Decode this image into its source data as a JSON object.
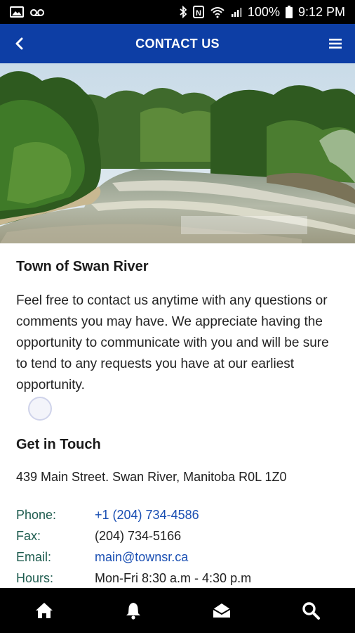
{
  "status_bar": {
    "battery": "100%",
    "time": "9:12 PM"
  },
  "app_bar": {
    "title": "CONTACT US"
  },
  "hero": {
    "alt": "River flowing through trees"
  },
  "content": {
    "org_name": "Town of Swan River",
    "intro": "Feel free to contact us anytime with any questions or comments you may have. We appreciate having the opportunity to communicate with you and will be sure to tend to any requests you have at our earliest opportunity.",
    "section_title": "Get in Touch",
    "address": "439 Main Street. Swan River, Manitoba R0L 1Z0",
    "contacts": [
      {
        "label": "Phone:",
        "value": "+1 (204) 734-4586"
      },
      {
        "label": "Fax:",
        "value": "(204) 734-5166"
      },
      {
        "label": "Email:",
        "value": "main@townsr.ca"
      },
      {
        "label": "Hours:",
        "value": "Mon-Fri 8:30 a.m - 4:30 p.m"
      }
    ]
  },
  "bottom_nav": {
    "items": [
      "home-icon",
      "bell-icon",
      "mail-icon",
      "search-icon"
    ]
  },
  "colors": {
    "app_bar": "#0d3ea5",
    "label": "#1e5c4f",
    "link": "#1a4fb3"
  }
}
